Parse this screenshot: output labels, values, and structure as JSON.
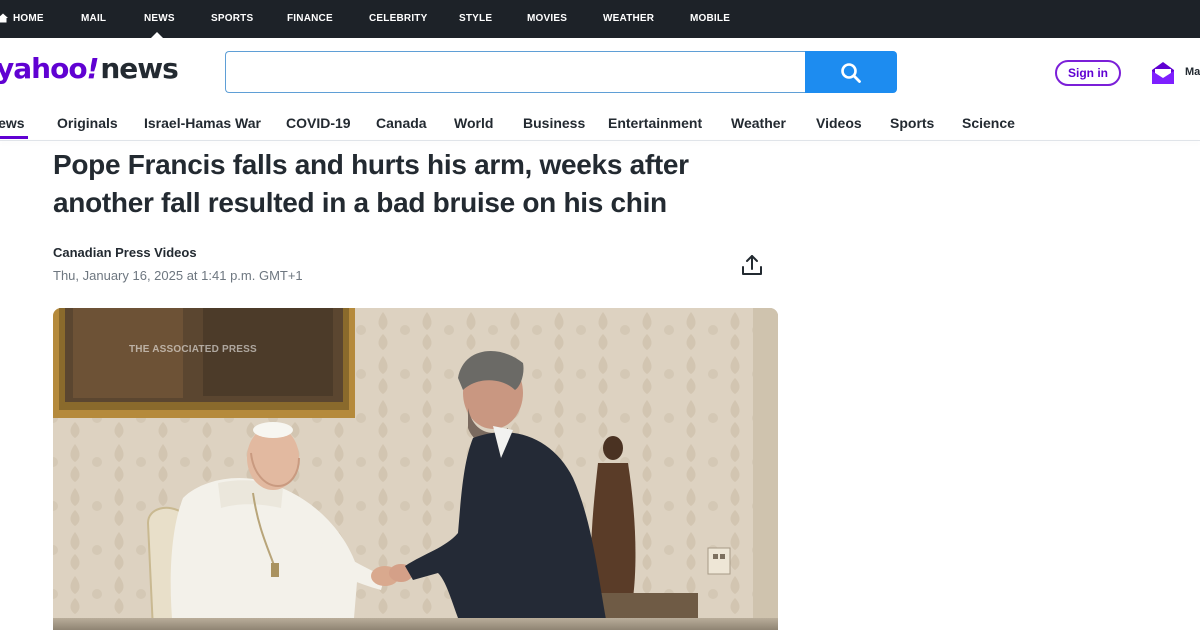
{
  "topnav": {
    "items": [
      "HOME",
      "MAIL",
      "NEWS",
      "SPORTS",
      "FINANCE",
      "CELEBRITY",
      "STYLE",
      "MOVIES",
      "WEATHER",
      "MOBILE"
    ],
    "active": "NEWS"
  },
  "brand": {
    "yahoo": "yahoo",
    "bang": "!",
    "news": "news"
  },
  "search": {
    "value": "",
    "placeholder": ""
  },
  "header": {
    "signin_label": "Sign in",
    "mail_label": "Ma"
  },
  "catnav": {
    "items": [
      "News",
      "Originals",
      "Israel-Hamas War",
      "COVID-19",
      "Canada",
      "World",
      "Business",
      "Entertainment",
      "Weather",
      "Videos",
      "Sports",
      "Science"
    ],
    "active": "News"
  },
  "article": {
    "headline": "Pope Francis falls and hurts his arm, weeks after another fall resulted in a bad bruise on his chin",
    "source": "Canadian Press Videos",
    "date": "Thu, January 16, 2025 at 1:41 p.m. GMT+1",
    "image_watermark": "THE ASSOCIATED PRESS"
  },
  "colors": {
    "topbar_bg": "#1d2228",
    "brand_purple": "#6001d2",
    "search_blue": "#1d8cf0"
  }
}
